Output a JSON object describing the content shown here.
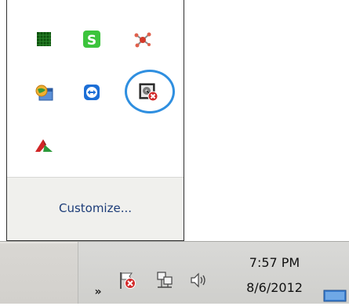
{
  "flyout": {
    "icons": [
      {
        "icon": "green-grid-app-icon"
      },
      {
        "icon": "green-s-app-icon"
      },
      {
        "icon": "red-network-app-icon"
      },
      {
        "icon": "globe-window-app-icon"
      },
      {
        "icon": "teamviewer-icon"
      },
      {
        "icon": "disconnected-drive-icon",
        "highlighted": true
      },
      {
        "icon": "red-green-triangle-icon"
      }
    ],
    "customize_label": "Customize..."
  },
  "taskbar": {
    "show_hidden_icons": "»",
    "tray_icons": [
      "action-center-flag-error-icon",
      "network-icon",
      "volume-icon"
    ],
    "clock": {
      "time": "7:57 PM",
      "date": "8/6/2012"
    },
    "show_desktop": "show-desktop-icon"
  },
  "colors": {
    "link": "#1c3c78",
    "highlight": "#2f8fe0",
    "taskbar": "#d2d0cc",
    "flyout_footer": "#f0f0ed"
  }
}
